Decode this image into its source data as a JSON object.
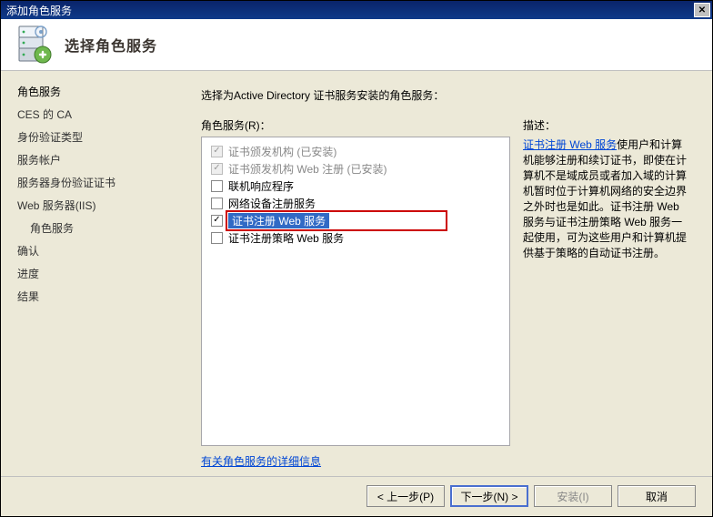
{
  "window": {
    "title": "添加角色服务"
  },
  "header": {
    "title": "选择角色服务"
  },
  "sidebar": {
    "items": [
      {
        "label": "角色服务",
        "active": true
      },
      {
        "label": "CES 的 CA"
      },
      {
        "label": "身份验证类型"
      },
      {
        "label": "服务帐户"
      },
      {
        "label": "服务器身份验证证书"
      },
      {
        "label": "Web 服务器(IIS)"
      },
      {
        "label": "角色服务",
        "sub": true
      },
      {
        "label": "确认"
      },
      {
        "label": "进度"
      },
      {
        "label": "结果"
      }
    ]
  },
  "content": {
    "instr": "选择为Active Directory 证书服务安装的角色服务：",
    "tree_label": "角色服务(R)：",
    "items": [
      {
        "label": "证书颁发机构  (已安装)",
        "checked": true,
        "disabled": true
      },
      {
        "label": "证书颁发机构 Web 注册  (已安装)",
        "checked": true,
        "disabled": true
      },
      {
        "label": "联机响应程序",
        "checked": false,
        "disabled": false
      },
      {
        "label": "网络设备注册服务",
        "checked": false,
        "disabled": false
      },
      {
        "label": "证书注册 Web 服务",
        "checked": true,
        "disabled": false,
        "selected": true
      },
      {
        "label": "证书注册策略 Web 服务",
        "checked": false,
        "disabled": false
      }
    ],
    "desc_label": "描述：",
    "desc_link": "证书注册 Web 服务",
    "desc_text": "使用户和计算机能够注册和续订证书，即使在计算机不是域成员或者加入域的计算机暂时位于计算机网络的安全边界之外时也是如此。证书注册 Web 服务与证书注册策略 Web 服务一起使用，可为这些用户和计算机提供基于策略的自动证书注册。",
    "more_link": "有关角色服务的详细信息"
  },
  "footer": {
    "prev": "< 上一步(P)",
    "next": "下一步(N) >",
    "install": "安装(I)",
    "cancel": "取消"
  }
}
